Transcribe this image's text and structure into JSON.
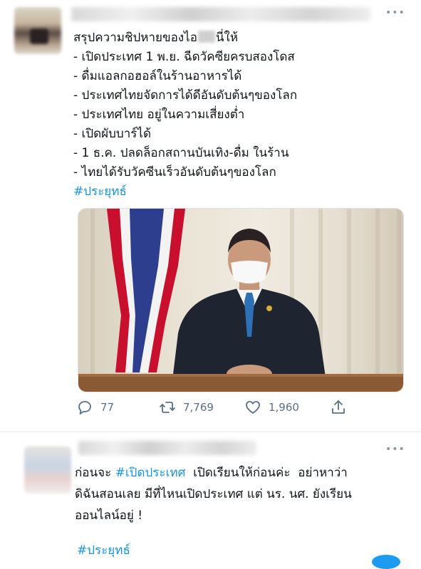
{
  "tweet1": {
    "more_icon": "•••",
    "lines": [
      "สรุปความชิปหายของไอ",
      "นี่ให้",
      "- เปิดประเทศ 1 พ.ย. ฉีดวัคซียครบสองโดส",
      "- ดื่มแอลกอฮอล์ในร้านอาหารได้",
      "- ประเทศไทยจัดการได้ดีอันดับต้นๆของโลก",
      "- ประเทศไทย อยู่ในความเสี่ยงต่ำ",
      "- เปิดผับบาร์ได้",
      "- 1 ธ.ค. ปลดล็อกสถานบันเทิง-ดื่ม ในร้าน",
      "- ไทยได้รับวัคซีนเร็วอันดับต้นๆของโลก"
    ],
    "hashtag": "#ประยุทธ์",
    "actions": {
      "reply_count": "77",
      "retweet_count": "7,769",
      "like_count": "1,960"
    }
  },
  "tweet2": {
    "more_icon": "•••",
    "line1_prefix": "ก่อนจะ ",
    "line1_hashtag": "#เปิดประเทศ",
    "line1_suffix": "  เปิดเรียนให้ก่อนค่ะ  อย่าหาว่า",
    "line2": "ดิฉันสอนเลย มีที่ไหนเปิดประเทศ แต่ นร. นศ. ยังเรียน",
    "line3": "ออนไลน์อยู่ !",
    "hashtag": "#ประยุทธ์"
  },
  "icons": {
    "reply": "reply-icon",
    "retweet": "retweet-icon",
    "like": "heart-icon",
    "share": "share-icon"
  },
  "colors": {
    "link": "#1b95e0",
    "icon": "#5b7083"
  }
}
